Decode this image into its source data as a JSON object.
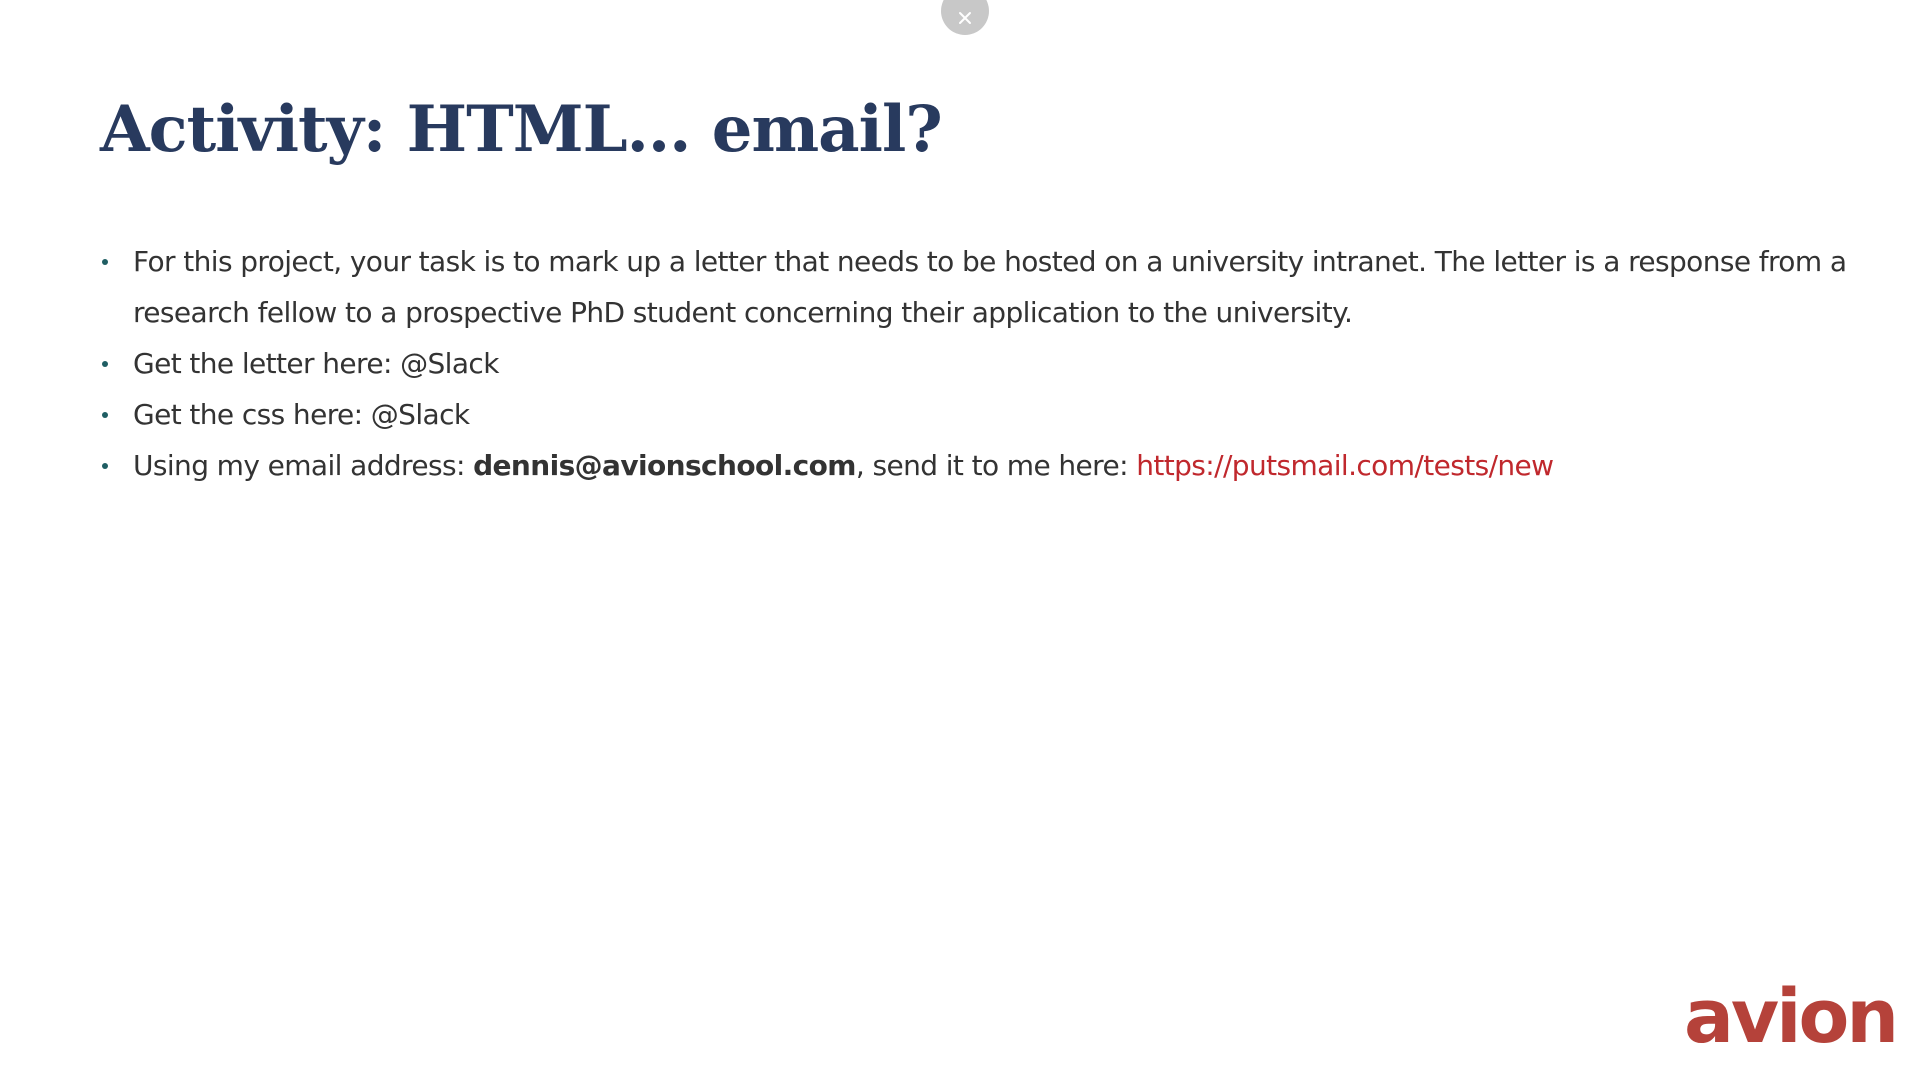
{
  "close_icon": "close-icon",
  "title": "Activity: HTML... email?",
  "bullets": [
    {
      "text": "For this project, your task is to mark up a letter that needs to be hosted on a university intranet. The letter is a response from a research fellow to a prospective PhD student concerning their application to the university."
    },
    {
      "text": "Get the letter here: @Slack"
    },
    {
      "text": "Get the css here: @Slack"
    },
    {
      "prefix": "Using my email address: ",
      "email": "dennis@avionschool.com",
      "middle": ", send it to me here: ",
      "link_text": "https://putsmail.com/tests/new"
    }
  ],
  "logo_text": "avion",
  "colors": {
    "title": "#283a5e",
    "body_text": "#333333",
    "bullet": "#1f5e63",
    "link": "#c0282d",
    "logo": "#b5423a",
    "close_button_bg": "#c8c8c8"
  }
}
